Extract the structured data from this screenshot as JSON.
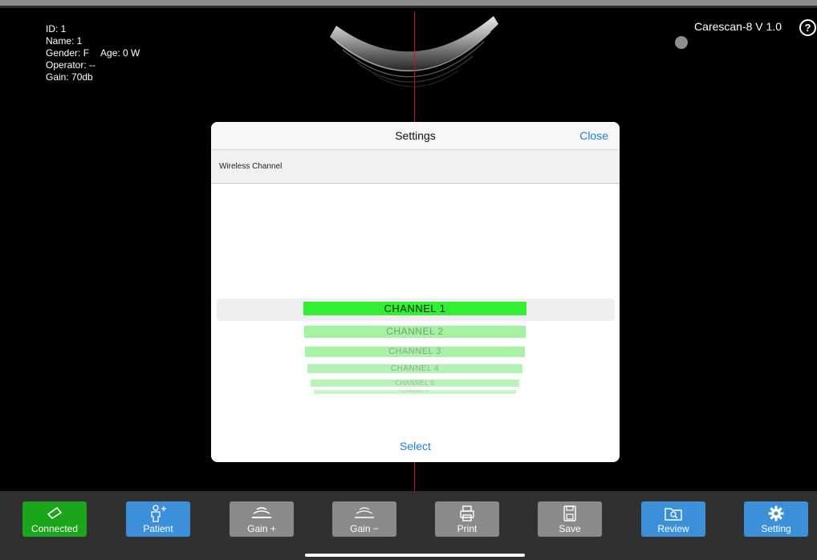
{
  "patient": {
    "id": "ID: 1",
    "name": "Name: 1",
    "gender": "Gender: F",
    "age": "Age: 0 W",
    "operator": "Operator: --",
    "gain": "Gain: 70db"
  },
  "device": {
    "label": "Carescan-8 V 1.0",
    "help_icon": "question-circle-icon"
  },
  "settings_dialog": {
    "title": "Settings",
    "close_label": "Close",
    "section_label": "Wireless Channel",
    "channels": [
      "CHANNEL 1",
      "CHANNEL 2",
      "CHANNEL 3",
      "CHANNEL 4",
      "CHANNEL 5",
      "CHANNEL 6"
    ],
    "selected_channel": "CHANNEL 1",
    "select_label": "Select"
  },
  "toolbar": {
    "connected": "Connected",
    "patient": "Patient",
    "gain_plus": "Gain +",
    "gain_minus": "Gain −",
    "print": "Print",
    "save": "Save",
    "review": "Review",
    "setting": "Setting"
  },
  "colors": {
    "accent_blue": "#3c8fd9",
    "connected_green": "#1aa51a",
    "selected_channel": "#33ee33",
    "center_line": "#d01010",
    "link_blue": "#1a7fe0"
  }
}
